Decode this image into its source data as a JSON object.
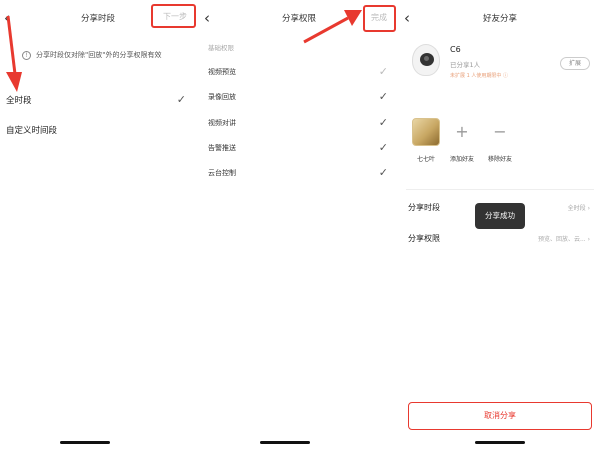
{
  "panel1": {
    "title": "分享时段",
    "next_label": "下一步",
    "info_text": "分享时段仅对除\"回放\"外的分享权限有效",
    "options": [
      {
        "label": "全时段",
        "checked": true
      },
      {
        "label": "自定义时间段",
        "checked": false
      }
    ]
  },
  "panel2": {
    "title": "分享权限",
    "done_label": "完成",
    "section_label": "基础权限",
    "permissions": [
      {
        "label": "视频预览",
        "checked": true,
        "state": "grey"
      },
      {
        "label": "录像回放",
        "checked": true
      },
      {
        "label": "视频对讲",
        "checked": true
      },
      {
        "label": "告警推送",
        "checked": true
      },
      {
        "label": "云台控制",
        "checked": true
      }
    ]
  },
  "panel3": {
    "title": "好友分享",
    "device": {
      "name": "C6",
      "shared_count": "已分享1人",
      "note": "未扩展 1 人使用期限中 ⓘ",
      "expand_label": "扩展"
    },
    "friends": [
      {
        "label": "七七叶",
        "type": "avatar"
      },
      {
        "label": "添加好友",
        "type": "add",
        "symbol": "+"
      },
      {
        "label": "移除好友",
        "type": "remove",
        "symbol": "−"
      }
    ],
    "settings": {
      "period_label": "分享时段",
      "period_value": "全时段",
      "perm_label": "分享权限",
      "perm_value": "预览、回放、云..."
    },
    "toast": "分享成功",
    "cancel_label": "取消分享"
  },
  "icons": {
    "back": "chevron-left-icon",
    "check": "checkmark-icon",
    "info": "info-icon"
  },
  "colors": {
    "accent_red": "#e8392f",
    "text": "#222222",
    "muted": "#aaaaaa"
  }
}
